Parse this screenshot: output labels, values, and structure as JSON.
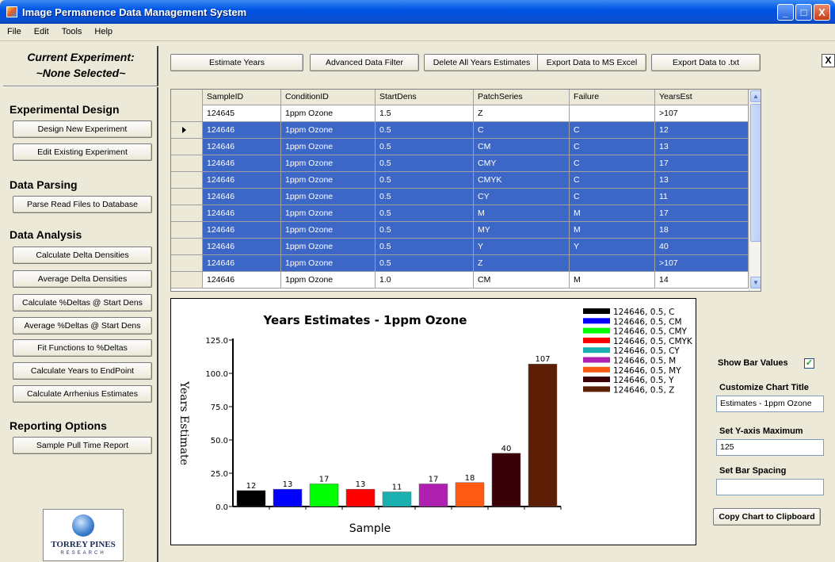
{
  "window": {
    "title": "Image Permanence Data Management System",
    "min": "_",
    "max": "□",
    "close": "X"
  },
  "menu": [
    "File",
    "Edit",
    "Tools",
    "Help"
  ],
  "sidebar": {
    "current_label": "Current Experiment:",
    "current_value": "~None Selected~",
    "sections": [
      {
        "title": "Experimental Design",
        "buttons": [
          "Design New Experiment",
          "Edit Existing Experiment"
        ]
      },
      {
        "title": "Data Parsing",
        "buttons": [
          "Parse Read Files to Database"
        ]
      },
      {
        "title": "Data Analysis",
        "buttons": [
          "Calculate Delta Densities",
          "Average Delta Densities",
          "Calculate %Deltas @ Start Dens",
          "Average %Deltas @ Start Dens",
          "Fit Functions to %Deltas",
          "Calculate Years to EndPoint",
          "Calculate Arrhenius Estimates"
        ]
      },
      {
        "title": "Reporting Options",
        "buttons": [
          "Sample Pull Time Report"
        ]
      }
    ],
    "logo": {
      "name": "TORREY PINES",
      "sub": "RESEARCH"
    }
  },
  "toolbar": [
    "Estimate Years",
    "Advanced Data Filter",
    "Delete All Years Estimates",
    "Export Data to MS Excel",
    "Export Data to .txt"
  ],
  "close_label": "X",
  "grid": {
    "columns": [
      "SampleID",
      "ConditionID",
      "StartDens",
      "PatchSeries",
      "Failure",
      "YearsEst"
    ],
    "rows": [
      {
        "cells": [
          "124645",
          "1ppm Ozone",
          "1.5",
          "Z",
          "",
          ">107"
        ],
        "selected": false,
        "current": false
      },
      {
        "cells": [
          "124646",
          "1ppm Ozone",
          "0.5",
          "C",
          "C",
          "12"
        ],
        "selected": true,
        "current": true
      },
      {
        "cells": [
          "124646",
          "1ppm Ozone",
          "0.5",
          "CM",
          "C",
          "13"
        ],
        "selected": true,
        "current": false
      },
      {
        "cells": [
          "124646",
          "1ppm Ozone",
          "0.5",
          "CMY",
          "C",
          "17"
        ],
        "selected": true,
        "current": false
      },
      {
        "cells": [
          "124646",
          "1ppm Ozone",
          "0.5",
          "CMYK",
          "C",
          "13"
        ],
        "selected": true,
        "current": false
      },
      {
        "cells": [
          "124646",
          "1ppm Ozone",
          "0.5",
          "CY",
          "C",
          "11"
        ],
        "selected": true,
        "current": false
      },
      {
        "cells": [
          "124646",
          "1ppm Ozone",
          "0.5",
          "M",
          "M",
          "17"
        ],
        "selected": true,
        "current": false
      },
      {
        "cells": [
          "124646",
          "1ppm Ozone",
          "0.5",
          "MY",
          "M",
          "18"
        ],
        "selected": true,
        "current": false
      },
      {
        "cells": [
          "124646",
          "1ppm Ozone",
          "0.5",
          "Y",
          "Y",
          "40"
        ],
        "selected": true,
        "current": false
      },
      {
        "cells": [
          "124646",
          "1ppm Ozone",
          "0.5",
          "Z",
          "",
          ">107"
        ],
        "selected": true,
        "current": false
      },
      {
        "cells": [
          "124646",
          "1ppm Ozone",
          "1.0",
          "CM",
          "M",
          "14"
        ],
        "selected": false,
        "current": false
      }
    ]
  },
  "chart_data": {
    "type": "bar",
    "title": "Years Estimates - 1ppm Ozone",
    "xlabel": "Sample",
    "ylabel": "Years Estimate",
    "ylim": [
      0,
      125
    ],
    "yticks": [
      "0.0",
      "25.0",
      "50.0",
      "75.0",
      "100.0",
      "125.0"
    ],
    "show_values": true,
    "legend_position": "top-right",
    "series": [
      {
        "name": "124646, 0.5, C",
        "value": 12,
        "color": "#000000"
      },
      {
        "name": "124646, 0.5, CM",
        "value": 13,
        "color": "#0000ff"
      },
      {
        "name": "124646, 0.5, CMY",
        "value": 17,
        "color": "#00ff00"
      },
      {
        "name": "124646, 0.5, CMYK",
        "value": 13,
        "color": "#ff0000"
      },
      {
        "name": "124646, 0.5, CY",
        "value": 11,
        "color": "#1ab0b0"
      },
      {
        "name": "124646, 0.5, M",
        "value": 17,
        "color": "#b020b0"
      },
      {
        "name": "124646, 0.5, MY",
        "value": 18,
        "color": "#ff5a14"
      },
      {
        "name": "124646, 0.5, Y",
        "value": 40,
        "color": "#3a0008"
      },
      {
        "name": "124646, 0.5, Z",
        "value": 107,
        "color": "#5c1e05"
      }
    ]
  },
  "right_panel": {
    "show_values_label": "Show Bar Values",
    "show_values_checked": "✓",
    "title_label": "Customize Chart Title",
    "title_value": "Estimates - 1ppm Ozone",
    "ymax_label": "Set Y-axis Maximum",
    "ymax_value": "125",
    "spacing_label": "Set Bar Spacing",
    "spacing_value": "",
    "copy_button": "Copy Chart to Clipboard"
  }
}
